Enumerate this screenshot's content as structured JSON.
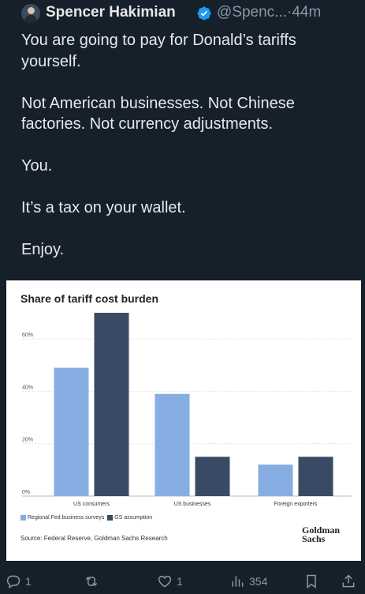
{
  "author": {
    "name": "Spencer Hakimian",
    "handle": "@Spenc...",
    "separator": "·",
    "time": "44m"
  },
  "tweet": {
    "text": "You are going to pay for Donald’s tariffs yourself.\n\nNot American businesses. Not Chinese factories. Not currency adjustments.\n\nYou.\n\nIt’s a tax on your wallet.\n\nEnjoy."
  },
  "chart_data": {
    "type": "bar",
    "title": "Share of tariff cost burden",
    "categories": [
      "US consumers",
      "US businesses",
      "Foreign exporters"
    ],
    "series": [
      {
        "name": "Regional Fed business surveys",
        "values": [
          49,
          39,
          12
        ],
        "color": "#86aee3"
      },
      {
        "name": "GS assumption",
        "values": [
          70,
          15,
          15
        ],
        "color": "#3a4a64"
      }
    ],
    "yticks": [
      "0%",
      "20%",
      "40%",
      "60%"
    ],
    "ylim": [
      0,
      70
    ],
    "grid": true,
    "legend": "bottom-left",
    "source": "Source: Federal Reserve, Goldman Sachs Research",
    "logo": [
      "Goldman",
      "Sachs"
    ]
  },
  "actions": {
    "replies": "1",
    "reposts": "",
    "likes": "1",
    "views": "354"
  },
  "colors": {
    "background": "#15202b",
    "text": "#e7e9ea",
    "muted": "#8b98a5",
    "verified": "#1d9bf0"
  }
}
